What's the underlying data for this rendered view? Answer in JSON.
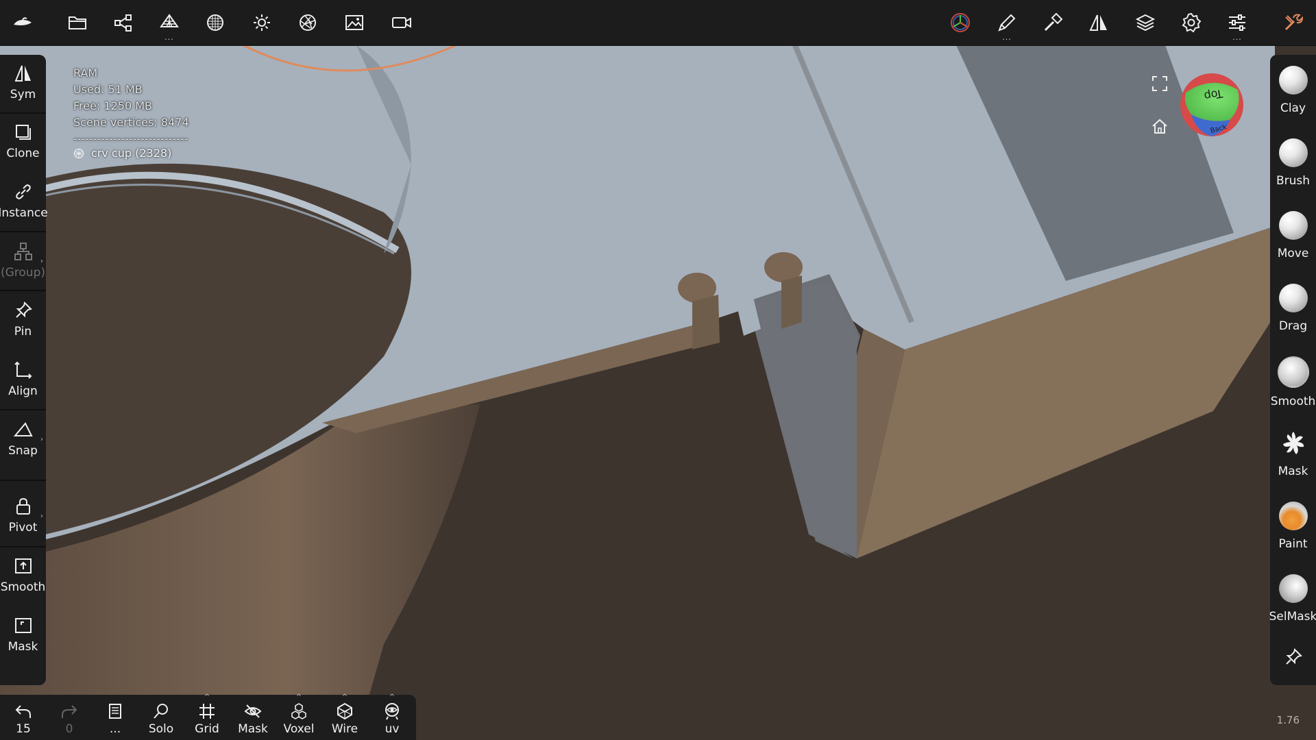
{
  "topbar": {
    "icons": [
      "logo-icon",
      "folder-icon",
      "share-icon",
      "topology-icon",
      "material-icon",
      "light-icon",
      "camera-aperture-icon",
      "background-image-icon",
      "video-camera-icon",
      "gizmo-icon",
      "paint-brush-icon",
      "tools-icon",
      "symmetry-icon",
      "layers-icon",
      "settings-icon",
      "sliders-icon",
      "wrench-icon"
    ]
  },
  "left_panel": {
    "sym": "Sym",
    "clone": "Clone",
    "instance": "Instance",
    "group": "(Group)",
    "pin": "Pin",
    "align": "Align",
    "snap": "Snap",
    "pivot": "Pivot",
    "smooth": "Smooth",
    "mask": "Mask"
  },
  "right_panel": {
    "clay": "Clay",
    "brush": "Brush",
    "move": "Move",
    "drag": "Drag",
    "smooth": "Smooth",
    "mask": "Mask",
    "paint": "Paint",
    "selmask": "SelMask"
  },
  "bottom_bar": {
    "undo": "15",
    "redo": "0",
    "menu": "...",
    "solo": "Solo",
    "grid": "Grid",
    "mask": "Mask",
    "voxel": "Voxel",
    "wire": "Wire",
    "uv": "uv"
  },
  "info": {
    "ram": "RAM",
    "used": "Used: 51 MB",
    "free": "Free: 1250 MB",
    "vertices": "Scene vertices: 8474",
    "separator": "-----------------------------",
    "mesh": "crv cup (2328)"
  },
  "view_cube": {
    "top": "Top",
    "back": "Back"
  },
  "version": "1.76",
  "colors": {
    "panel": "#1d1d1e",
    "surface_top": "#a5b0bb",
    "surface_side": "#7e6a57",
    "background": "#3d342e",
    "accent_orange": "#e08a5c"
  }
}
